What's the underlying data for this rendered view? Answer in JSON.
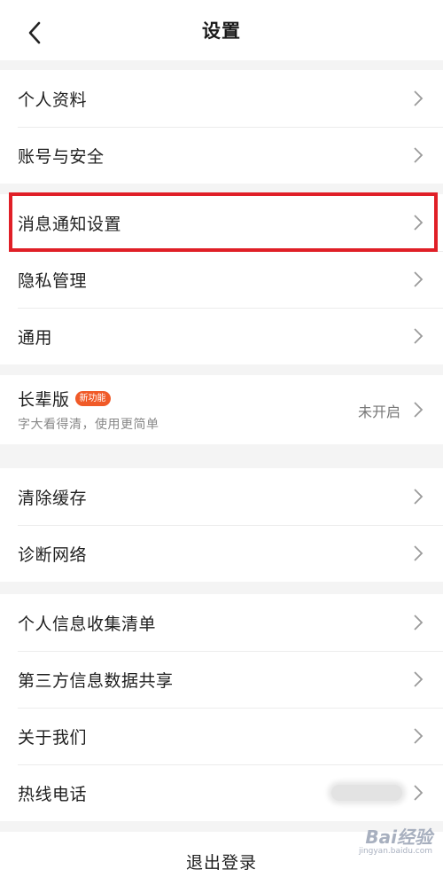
{
  "header": {
    "title": "设置",
    "back_icon": "chevron-left-icon"
  },
  "groups": [
    {
      "items": [
        {
          "label": "个人资料"
        },
        {
          "label": "账号与安全"
        }
      ]
    },
    {
      "items": [
        {
          "label": "消息通知设置",
          "highlighted": true
        },
        {
          "label": "隐私管理"
        },
        {
          "label": "通用"
        }
      ]
    },
    {
      "elder": {
        "label": "长辈版",
        "badge": "新功能",
        "subtitle": "字大看得清，使用更简单",
        "value": "未开启"
      }
    },
    {
      "items": [
        {
          "label": "清除缓存"
        },
        {
          "label": "诊断网络"
        }
      ]
    },
    {
      "items": [
        {
          "label": "个人信息收集清单"
        },
        {
          "label": "第三方信息数据共享"
        },
        {
          "label": "关于我们"
        },
        {
          "label": "热线电话"
        }
      ]
    }
  ],
  "logout": {
    "label": "退出登录"
  },
  "watermark": {
    "brand": "Bai经验",
    "url": "jingyan.baidu.com"
  },
  "colors": {
    "highlight": "#e01f27",
    "badge": "#f05a28",
    "background": "#f4f4f4"
  }
}
